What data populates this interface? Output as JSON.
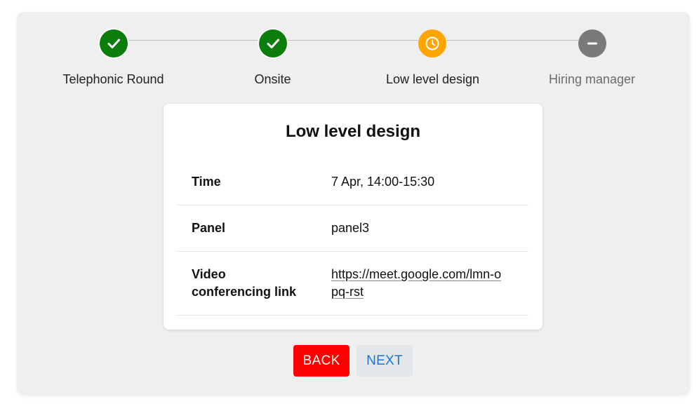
{
  "stepper": {
    "steps": [
      {
        "label": "Telephonic Round",
        "status": "completed",
        "icon": "check-icon"
      },
      {
        "label": "Onsite",
        "status": "completed",
        "icon": "check-icon"
      },
      {
        "label": "Low level design",
        "status": "in-progress",
        "icon": "clock-icon"
      },
      {
        "label": "Hiring manager",
        "status": "pending",
        "icon": "minus-icon"
      }
    ]
  },
  "card": {
    "title": "Low level design",
    "rows": [
      {
        "label": "Time",
        "value": "7 Apr, 14:00-15:30"
      },
      {
        "label": "Panel",
        "value": "panel3"
      },
      {
        "label": "Video conferencing link",
        "value": "https://meet.google.com/lmn-opq-rst"
      }
    ]
  },
  "actions": {
    "back_label": "BACK",
    "next_label": "NEXT"
  },
  "colors": {
    "completed": "#0a7d0a",
    "in_progress": "#ffa500",
    "pending": "#7a7a7a",
    "back_button": "#ff0000",
    "next_text": "#1e73c9"
  }
}
